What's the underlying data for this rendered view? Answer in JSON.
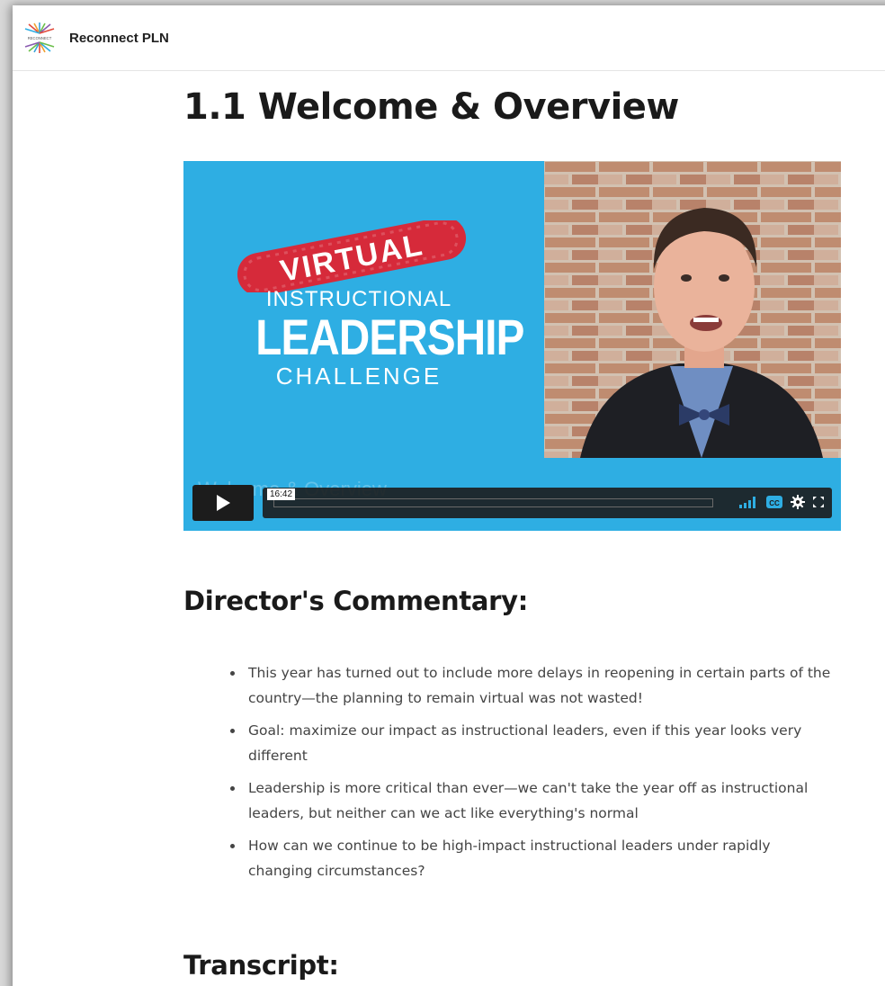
{
  "header": {
    "brand": "Reconnect PLN",
    "logo_text": "RECONNECT"
  },
  "lesson": {
    "title": "1.1 Welcome & Overview"
  },
  "video": {
    "stamp_text": "VIRTUAL",
    "course_line1": "INSTRUCTIONAL",
    "course_line2": "LEADERSHIP",
    "course_line3": "CHALLENGE",
    "ghost_title": "Welcome & Overview",
    "duration": "16:42",
    "progress": 0,
    "colors": {
      "background": "#2eaee3",
      "stamp": "#d62a3a"
    },
    "icons": [
      "play-icon",
      "volume-icon",
      "captions-icon",
      "settings-icon",
      "fullscreen-icon"
    ]
  },
  "commentary": {
    "heading": "Director's Commentary:",
    "items": [
      "This year has turned out to include more delays in reopening in certain parts of the country—the planning to remain virtual was not wasted!",
      "Goal: maximize our impact as instructional leaders, even if this year looks very different",
      "Leadership is more critical than ever—we can't take the year off as instructional leaders, but neither can we act like everything's normal",
      "How can we continue to be high-impact instructional leaders under rapidly changing circumstances?"
    ]
  },
  "transcript": {
    "heading": "Transcript:"
  }
}
